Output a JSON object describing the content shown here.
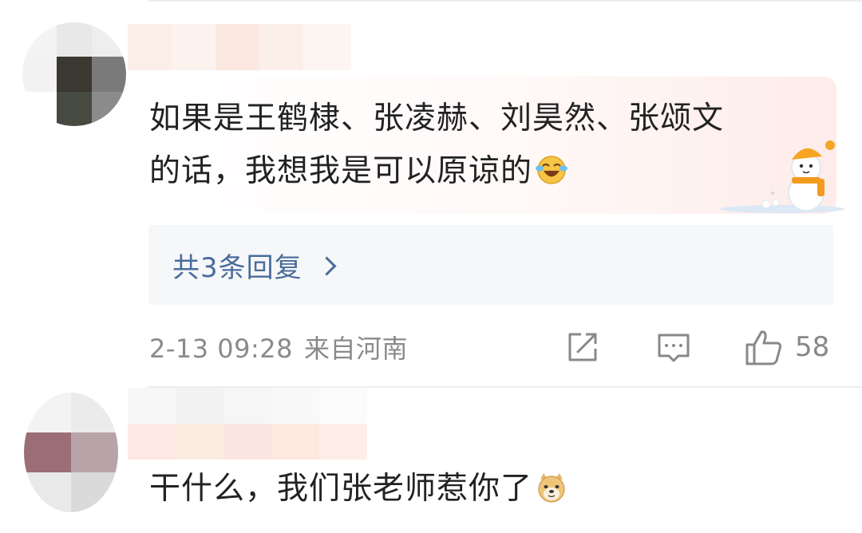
{
  "comments": [
    {
      "text_line1": "如果是王鹤棣、张凌赫、刘昊然、张颂文",
      "text_line2": "的话，我想我是可以原谅的",
      "emoji": "laughing-crying-emoji",
      "sticker": "snowman-sticker",
      "replies_label": "共3条回复",
      "date": "2-13 09:28",
      "location": "来自河南",
      "actions": {
        "share_icon": "share-icon",
        "reply_icon": "comment-icon",
        "like_icon": "thumbs-up-icon",
        "like_count": "58"
      }
    },
    {
      "text": "干什么，我们张老师惹你了",
      "emoji": "doge-emoji"
    }
  ],
  "colors": {
    "text": "#222222",
    "link": "#4a6c9b",
    "meta": "#8a8a8a",
    "reply_box": "#f6f7f9",
    "icon": "#888888"
  }
}
